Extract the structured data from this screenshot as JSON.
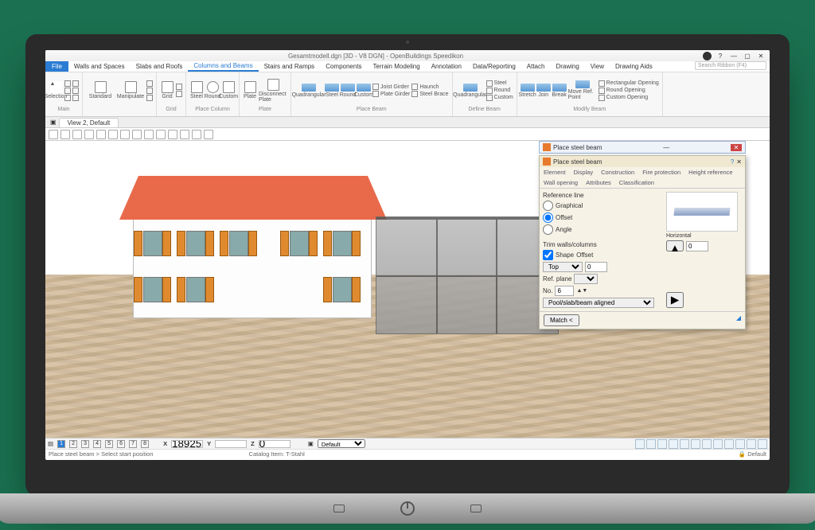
{
  "window": {
    "title": "Gesamtmodell.dgn [3D - V8 DGN] - OpenBuildings Speedikon",
    "min": "—",
    "max": "▢",
    "close": "✕"
  },
  "menu": {
    "file": "File",
    "tabs": [
      "Walls and Spaces",
      "Slabs and Roofs",
      "Columns and Beams",
      "Stairs and Ramps",
      "Components",
      "Terrain Modeling",
      "Annotation",
      "Data/Reporting",
      "Attach",
      "Drawing",
      "View",
      "Drawing Aids"
    ],
    "search_ph": "Search Ribbon (F4)",
    "active_index": 2
  },
  "ribbon": {
    "groups": [
      {
        "label": "Main",
        "items": [
          "Selection",
          "",
          ""
        ]
      },
      {
        "label": "",
        "items": [
          "Standard",
          "Manipulate"
        ]
      },
      {
        "label": "Grid",
        "items": [
          "Grid",
          "",
          ""
        ]
      },
      {
        "label": "Place Column",
        "items": [
          "Steel",
          "Round",
          "Custom"
        ]
      },
      {
        "label": "Plate",
        "items": [
          "Plate",
          "Disconnect Plate"
        ]
      },
      {
        "label": "Place Beam",
        "items": [
          "Quadrangular",
          "Steel",
          "Round",
          "Custom"
        ],
        "extras": [
          "Joist Girder",
          "Plate Girder",
          "Haunch",
          "Steel Brace"
        ]
      },
      {
        "label": "Define Beam",
        "items": [
          "Quadrangular"
        ],
        "extras": [
          "Steel",
          "Round",
          "Custom"
        ]
      },
      {
        "label": "Modify Beam",
        "items": [
          "Stretch",
          "Join",
          "Break",
          "Move Ref. Point"
        ],
        "extras": [
          "Rectangular Opening",
          "Round Opening",
          "Custom Opening"
        ]
      }
    ]
  },
  "viewtab": "View 2, Default",
  "floating_title": "Place steel beam",
  "panel": {
    "title": "Place steel beam",
    "tabs": [
      "Element",
      "Display",
      "Construction",
      "Fire protection",
      "Height reference",
      "Wall opening",
      "Attributes",
      "Classification"
    ],
    "reference_label": "Reference line",
    "ref_opts": [
      "Graphical",
      "Offset",
      "Angle"
    ],
    "trim_label": "Trim walls/columns",
    "shape_check": "Shape",
    "top": "Top",
    "offset_label": "Offset",
    "offset_val": "0",
    "horiz_label": "Horizontal",
    "ref_plane": "Ref. plane",
    "no_label": "No.",
    "no_val": "6",
    "assembly": "Pool/slab/beam aligned",
    "match": "Match <"
  },
  "status": {
    "nums": [
      "1",
      "2",
      "3",
      "4",
      "5",
      "6",
      "7",
      "8"
    ],
    "coords": {
      "X": "X",
      "xv": "18925",
      "Y": "Y",
      "yv": "",
      "Z": "Z",
      "zv": "0"
    },
    "mode": "Default",
    "msg": "Place steel beam > Select start position",
    "catalog": "Catalog Item: T-Stahl",
    "lock": "Default"
  }
}
